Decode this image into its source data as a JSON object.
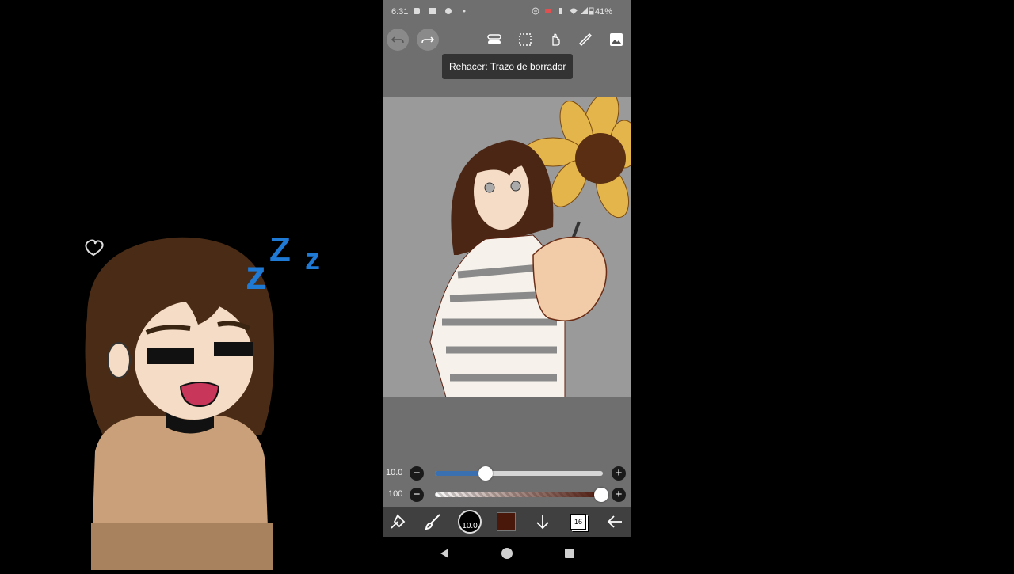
{
  "status_bar": {
    "time": "6:31",
    "battery": "41%"
  },
  "toolbar": {
    "buttons": [
      "undo-icon",
      "redo-icon",
      "settings-toggle-icon",
      "selection-icon",
      "hand-icon",
      "ruler-icon",
      "image-icon"
    ]
  },
  "tooltip": {
    "text": "Rehacer: Trazo de borrador"
  },
  "sliders": {
    "brush_size": {
      "label": "10.0",
      "value": 10.0,
      "fraction": 0.3
    },
    "opacity": {
      "label": "100",
      "value": 100,
      "fraction": 1.0
    }
  },
  "bottom_bar": {
    "brush_size_display": "10.0",
    "layer_count": "16",
    "current_color": "#4a170b"
  },
  "colors": {
    "phone_bg": "#6f6f6f",
    "canvas_bg": "#999999",
    "accent_blue": "#3a6fb0"
  }
}
